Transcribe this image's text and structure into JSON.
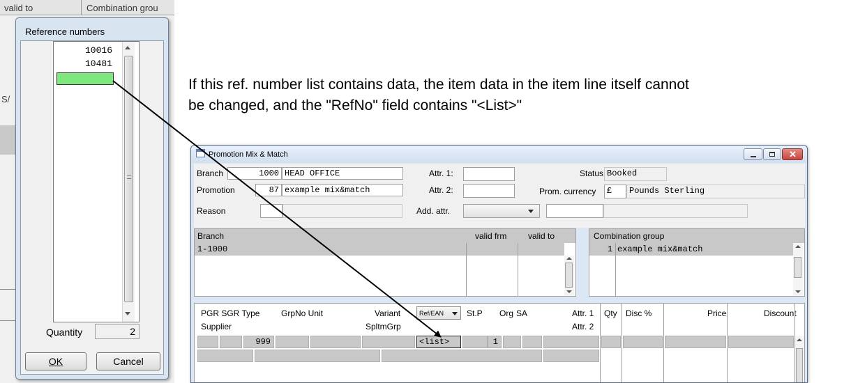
{
  "background_window": {
    "col_valid_to": "valid to",
    "col_combination_group": "Combination grou",
    "partial_label": "S/"
  },
  "refdialog": {
    "title": "Reference numbers",
    "items": [
      "10016",
      "10481"
    ],
    "new_entry_color": "#7ee87e",
    "quantity_label": "Quantity",
    "quantity_value": "2",
    "ok_label": "OK",
    "cancel_label": "Cancel"
  },
  "annotation": {
    "line1": "If this ref. number list contains data, the item data in the item line itself cannot",
    "line2": "be changed, and the \"RefNo\" field contains \"<List>\""
  },
  "promo": {
    "title": "Promotion Mix & Match",
    "branch_label": "Branch",
    "branch_no": "1000",
    "branch_name": "HEAD OFFICE",
    "promotion_label": "Promotion",
    "promotion_no": "87",
    "promotion_name": "example mix&match",
    "reason_label": "Reason",
    "attr1_label": "Attr. 1:",
    "attr2_label": "Attr. 2:",
    "addattr_label": "Add. attr.",
    "status_label": "Status",
    "status_value": "Booked",
    "currency_label": "Prom. currency",
    "currency_symbol": "£",
    "currency_name": "Pounds Sterling",
    "branch_table": {
      "headers": [
        "Branch",
        "valid frm",
        "valid to"
      ],
      "rows": [
        [
          "1-1000",
          "",
          ""
        ]
      ]
    },
    "combo_table": {
      "header": "Combination group",
      "rows": [
        {
          "no": "1",
          "name": "example mix&match"
        }
      ]
    },
    "item_headers": {
      "pgr_sgr_type": "PGR SGR  Type",
      "grpno_unit": "GrpNo Unit",
      "variant": "Variant",
      "refean_select": "Ref/EAN",
      "stp": "St.P",
      "org": "Org",
      "sa": "SA",
      "attr1": "Attr. 1",
      "qty": "Qty",
      "disc": "Disc %",
      "price": "Price",
      "discount": "Discount",
      "supplier": "Supplier",
      "spltmgrp": "SpltmGrp",
      "attr2": "Attr. 2"
    },
    "item_row": {
      "type": "999",
      "refno": "<list>",
      "stp": "1"
    }
  },
  "colors": {
    "titlebar": "#dbe7f5",
    "close_button": "#c9463d",
    "grid_cell": "#c8c8c8",
    "green_cell": "#7ee87e"
  }
}
